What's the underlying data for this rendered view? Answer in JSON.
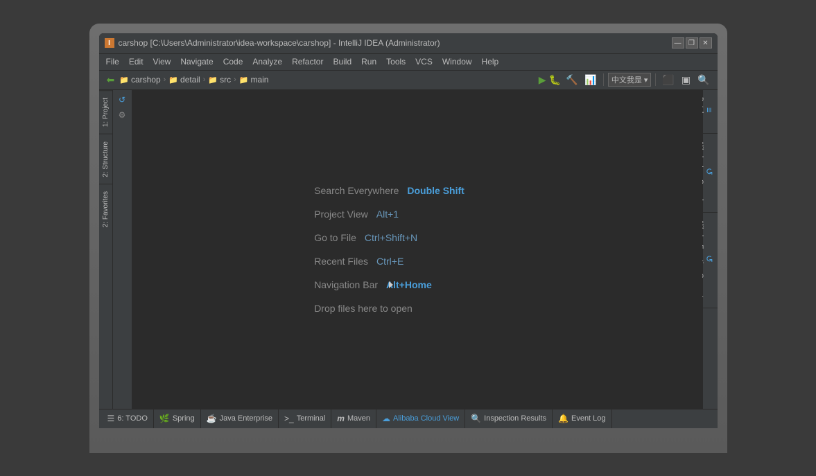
{
  "window": {
    "title": "carshop [C:\\Users\\Administrator\\idea-workspace\\carshop] - IntelliJ IDEA (Administrator)",
    "minimize_label": "—",
    "restore_label": "❐",
    "close_label": "✕"
  },
  "menubar": {
    "items": [
      "File",
      "Edit",
      "View",
      "Navigate",
      "Code",
      "Analyze",
      "Refactor",
      "Build",
      "Run",
      "Tools",
      "VCS",
      "Window",
      "Help"
    ]
  },
  "breadcrumb": {
    "items": [
      "carshop",
      "detail",
      "src",
      "main"
    ],
    "lang": "中文我是",
    "lang_dropdown": "▾"
  },
  "shortcuts": {
    "search_everywhere_label": "Search Everywhere",
    "search_everywhere_key": "Double Shift",
    "project_view_label": "Project View",
    "project_view_key": "Alt+1",
    "goto_file_label": "Go to File",
    "goto_file_key": "Ctrl+Shift+N",
    "recent_files_label": "Recent Files",
    "recent_files_key": "Ctrl+E",
    "navigation_bar_label": "Navigation Bar",
    "navigation_bar_key": "Alt+Home",
    "drop_files_label": "Drop files here to open"
  },
  "left_tabs": [
    {
      "label": "1: Project",
      "active": false
    },
    {
      "label": "2: Structure",
      "active": false
    },
    {
      "label": "2: Favorites",
      "active": false
    }
  ],
  "right_tabs": [
    {
      "label": "Database",
      "icon": "≡"
    },
    {
      "label": "Alibaba Log Console",
      "icon": "↺"
    },
    {
      "label": "Alibaba Function Compute",
      "icon": "↺"
    }
  ],
  "bottom_tabs": [
    {
      "label": "6: TODO",
      "icon": "☰",
      "active": false
    },
    {
      "label": "Spring",
      "icon": "🌿",
      "active": false
    },
    {
      "label": "Java Enterprise",
      "icon": "☕",
      "active": false
    },
    {
      "label": "Terminal",
      "icon": ">_",
      "active": false
    },
    {
      "label": "Maven",
      "icon": "m",
      "active": false
    },
    {
      "label": "Alibaba Cloud View",
      "icon": "☁",
      "active": true
    },
    {
      "label": "Inspection Results",
      "icon": "🔍",
      "active": false
    },
    {
      "label": "Event Log",
      "icon": "🔔",
      "active": false
    }
  ],
  "toolbar": {
    "run_icon": "▶",
    "debug_icon": "🐛",
    "build_icon": "🔨",
    "search_icon": "🔍"
  }
}
